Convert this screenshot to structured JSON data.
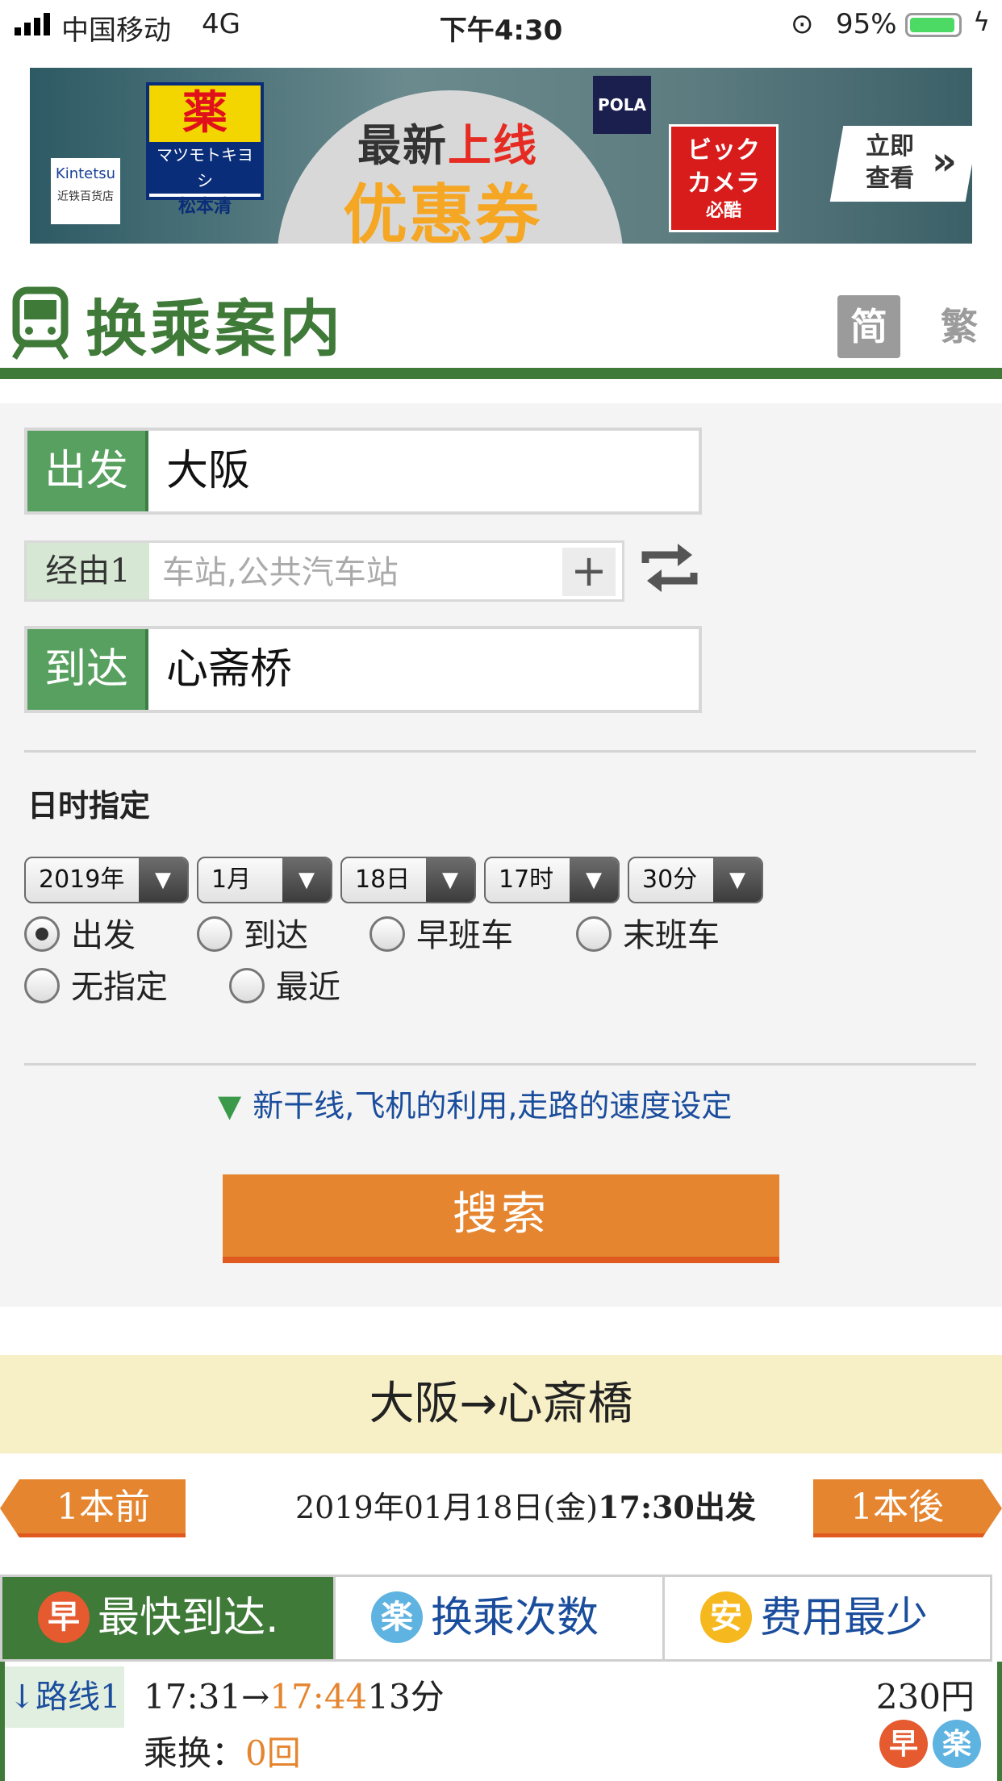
{
  "status_bar": {
    "carrier": "中国移动",
    "network": "4G",
    "time": "下午4:30",
    "battery_pct": "95%"
  },
  "banner": {
    "left_logo": "Kintetsu",
    "left_logo_sub": "近铁百货店",
    "mk_char": "薬",
    "mk_latin": "マツモトキヨシ",
    "mk_name": "松本清",
    "headline_1a": "最新",
    "headline_1b": "上线",
    "headline_2": "优惠券",
    "pola": "POLA",
    "bic_1": "ビック",
    "bic_2": "カメラ",
    "bic_3": "必酷",
    "cta": "立即查看"
  },
  "header": {
    "title": "换乘案内",
    "lang_simplified": "简",
    "lang_traditional": "繁"
  },
  "form": {
    "from_label": "出发",
    "from_value": "大阪",
    "via_label": "经由1",
    "via_placeholder": "车站,公共汽车站",
    "via_add": "+",
    "to_label": "到达",
    "to_value": "心斋桥",
    "datetime_title": "日时指定",
    "selects": {
      "year": "2019年",
      "month": "1月",
      "day": "18日",
      "hour": "17时",
      "minute": "30分"
    },
    "radios": [
      "出发",
      "到达",
      "早班车",
      "末班车",
      "无指定",
      "最近"
    ],
    "selected_radio": "出发",
    "options_link": "新干线,飞机的利用,走路的速度设定",
    "search_button": "搜索"
  },
  "result": {
    "route": "大阪→心斎橋",
    "prev_button": "1本前",
    "next_button": "1本後",
    "date": "2019年01月18日(金)",
    "time_dir": "17:30出发",
    "tabs": [
      {
        "badge": "早",
        "label": "最快到达."
      },
      {
        "badge": "楽",
        "label": "换乘次数"
      },
      {
        "badge": "安",
        "label": "费用最少"
      }
    ],
    "route1": {
      "label": "↓路线1",
      "depart": "17:31→",
      "arrive": "17:44",
      "duration": "13分",
      "price": "230円",
      "transfer_label": "乘换：",
      "transfer_count": "0回",
      "badges": [
        "早",
        "楽"
      ]
    }
  },
  "colors": {
    "green": "#3f7a39",
    "orange": "#e5852f",
    "link_blue": "#1a4d9c",
    "panel_bg": "#f4f4f4"
  }
}
